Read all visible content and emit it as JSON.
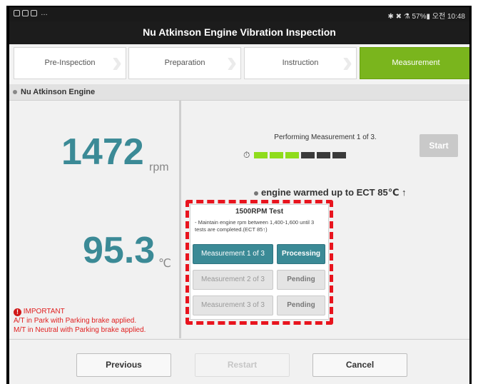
{
  "status_bar": {
    "right": "✱ ✖ ⚗ 57%▮ 오전 10:48"
  },
  "title": "Nu Atkinson Engine Vibration Inspection",
  "steps": [
    {
      "label": "Pre-Inspection"
    },
    {
      "label": "Preparation"
    },
    {
      "label": "Instruction"
    },
    {
      "label": "Measurement"
    }
  ],
  "engine_label": "Nu Atkinson Engine",
  "rpm": {
    "value": "1472",
    "unit": "rpm"
  },
  "temp": {
    "value": "95.3",
    "unit": "℃"
  },
  "important": {
    "title": "IMPORTANT",
    "line1": "A/T in Park with Parking brake applied.",
    "line2": "M/T in Neutral with Parking brake applied."
  },
  "measurement": {
    "performing": "Performing Measurement 1 of 3.",
    "progress_completed": 3,
    "progress_total": 6,
    "start_label": "Start",
    "warm_text": "engine warmed up to ECT 85℃ ↑"
  },
  "test": {
    "title": "1500RPM Test",
    "desc": "- Maintain engine rpm between 1,400-1,600 until 3 tests are completed.(ECT 85↑)",
    "rows": [
      {
        "label": "Measurement 1 of 3",
        "status": "Processing"
      },
      {
        "label": "Measurement 2 of 3",
        "status": "Pending"
      },
      {
        "label": "Measurement 3 of 3",
        "status": "Pending"
      }
    ]
  },
  "footer": {
    "previous": "Previous",
    "restart": "Restart",
    "cancel": "Cancel"
  },
  "colors": {
    "accent": "#3b8a96",
    "step_active": "#7ab51d",
    "progress_on": "#8fdc1c",
    "progress_off": "#3a3a3a",
    "alert": "#e02020"
  }
}
